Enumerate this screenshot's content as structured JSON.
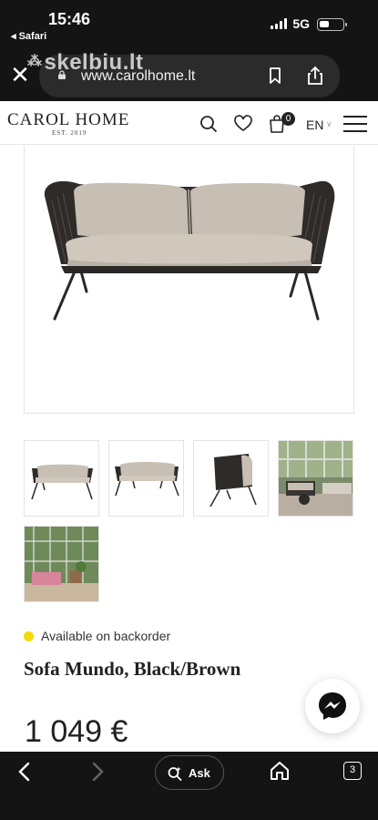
{
  "status_bar": {
    "time": "15:46",
    "back_app": "◂ Safari",
    "network": "5G"
  },
  "browser": {
    "url": "www.carolhome.lt",
    "watermark": "skelbiu.lt",
    "ask_label": "Ask",
    "tab_count": "3"
  },
  "site": {
    "logo": "CAROL HOME",
    "logo_sub": "EST. 2019",
    "cart_count": "0",
    "language": "EN"
  },
  "product": {
    "availability": "Available on backorder",
    "title": "Sofa Mundo, Black/Brown",
    "price": "1 049 €",
    "thumbnail_count": 5
  },
  "colors": {
    "availability_dot": "#f5d90a",
    "chrome": "#141414",
    "text": "#222222"
  }
}
